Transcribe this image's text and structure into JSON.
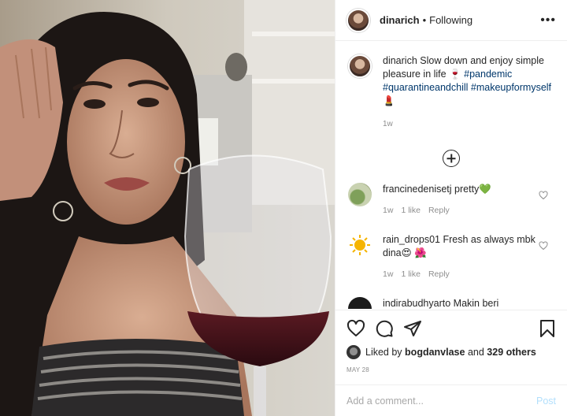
{
  "header": {
    "username": "dinarich",
    "separator": "•",
    "follow_status": "Following",
    "more": "•••"
  },
  "caption": {
    "username": "dinarich",
    "text": "Slow down and enjoy simple pleasure in life",
    "emoji1": "🍷",
    "tags": [
      "#pandemic",
      "#quarantineandchill",
      "#makeupformyself"
    ],
    "emoji2": "💄",
    "time": "1w"
  },
  "comments": [
    {
      "username": "francinedenisetj",
      "text": "pretty💚",
      "time": "1w",
      "likes": "1 like",
      "reply": "Reply"
    },
    {
      "username": "rain_drops01",
      "text": "Fresh as always mbk dina😍 🌺",
      "time": "1w",
      "likes": "1 like",
      "reply": "Reply"
    },
    {
      "username": "indirabudhyarto",
      "text": "Makin beri",
      "time": "",
      "likes": "",
      "reply": ""
    }
  ],
  "likes": {
    "prefix": "Liked by",
    "user": "bogdanvlase",
    "middle": "and",
    "others": "329 others"
  },
  "date": "MAY 28",
  "add_comment": {
    "placeholder": "Add a comment...",
    "post_label": "Post"
  },
  "colors": {
    "hashtag": "#00376b",
    "muted": "#8e8e8e",
    "post_disabled": "#b2dffc"
  }
}
